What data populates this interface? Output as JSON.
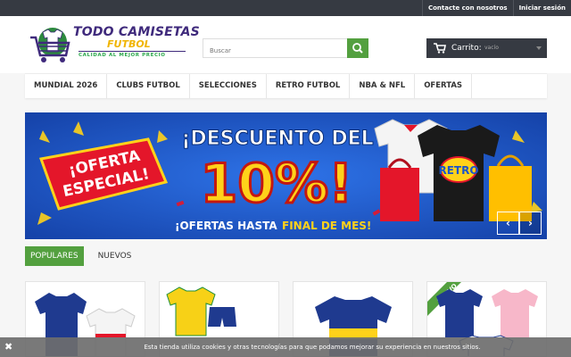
{
  "topbar": {
    "contact": "Contacte con nosotros",
    "login": "Iniciar sesión"
  },
  "logo": {
    "line1": "TODO CAMISETAS",
    "line2": "FUTBOL",
    "tagline": "CALIDAD AL MEJOR PRECIO"
  },
  "search": {
    "placeholder": "Buscar",
    "icon": "search-icon"
  },
  "cart": {
    "label": "Carrito:",
    "value": "vacío",
    "icon": "shopping-cart-icon"
  },
  "nav": {
    "items": [
      "MUNDIAL 2026",
      "CLUBS FUTBOL",
      "SELECCIONES",
      "RETRO FUTBOL",
      "NBA & NFL",
      "OFERTAS"
    ]
  },
  "banner": {
    "badge_line1": "¡OFERTA",
    "badge_line2": "ESPECIAL!",
    "headline": "¡DESCUENTO DEL",
    "percent": "10%!",
    "footer_white": "¡OFERTAS HASTA",
    "footer_yellow": "FINAL DE MES!",
    "shirt_text": "RETRO",
    "prev": "‹",
    "next": "›",
    "colors": {
      "bg": "#1c55c9",
      "yellow": "#ffd21a",
      "red": "#e4162a"
    }
  },
  "tabs": {
    "popular": "POPULARES",
    "new": "NUEVOS"
  },
  "products": {
    "new_ribbon": "NUEVO"
  },
  "cookie": {
    "close": "✖",
    "message": "Esta tienda utiliza cookies y otras tecnologías para que podamos mejorar su experiencia en nuestros sitios."
  },
  "colors": {
    "accent": "#53a03f",
    "dark": "#363a42"
  }
}
